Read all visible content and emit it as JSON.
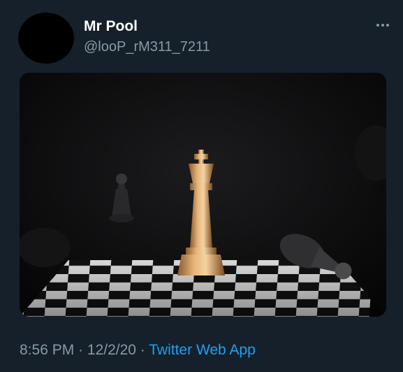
{
  "tweet": {
    "display_name": "Mr Pool",
    "handle": "@looP_rM311_7211",
    "time": "8:56 PM",
    "separator": " · ",
    "date": "12/2/20",
    "source": "Twitter Web App",
    "more_icon": "more-horizontal-icon"
  },
  "media": {
    "description_icon": "chess-image",
    "colors": {
      "background": "#15202b",
      "name": "#ffffff",
      "secondary": "#8899a6",
      "link": "#1da1f2",
      "king_gold": "#c9965a",
      "pawn_dark": "#2c2c2e"
    }
  }
}
